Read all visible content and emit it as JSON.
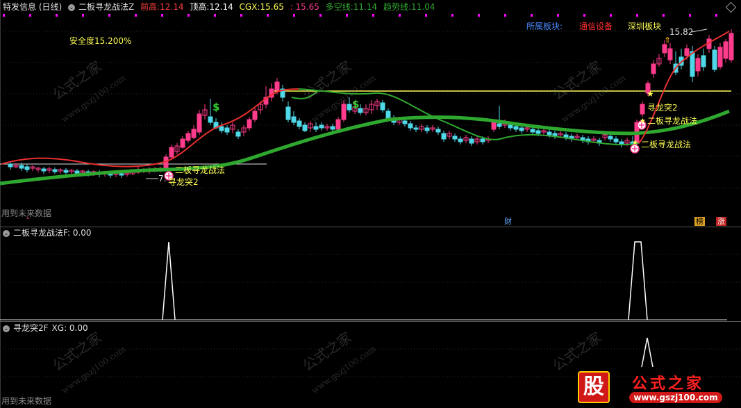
{
  "top_header": {
    "title": "特发信息 (日线)",
    "formula": "二板寻龙战法Z",
    "prev_high_label": "前高:",
    "prev_high_value": "12.14",
    "top_high_label": "顶高:",
    "top_high_value": "12.14",
    "cgx_label": "CGX:",
    "cgx_value": "15.65",
    "cgx_extra": ": 15.65",
    "duokong_label": "多空线:",
    "duokong_value": "11.14",
    "trend_label": "趋势线:",
    "trend_value": "11.04"
  },
  "main_panel": {
    "safety": "安全度15.200%",
    "sector_label": "所属板块:",
    "sector_1": "通信设备",
    "sector_2": "深圳板块",
    "label_dragon_1": "二板寻龙战法",
    "label_breakout_1": "寻龙突2",
    "label_low_price": "7.",
    "label_breakout_2": "寻龙突2",
    "label_dragon_2": "二板寻龙战法",
    "label_dragon_3": "二板寻龙战法",
    "label_high_price": "15.82",
    "dollar_1": "$",
    "dollar_2": "$",
    "future_data": "用到未来数据",
    "badge_cai": "财",
    "badge_bang": "榜",
    "badge_zhang": "涨"
  },
  "panel2": {
    "title": "二板寻龙战法F",
    "value": ": 0.00"
  },
  "panel3": {
    "title": "寻龙突2F",
    "xg": "XG: 0.00",
    "future_data": "用到未来数据"
  },
  "watermark": {
    "brand": "公式之家",
    "site": "www.gszj100.com",
    "logo_char": "股",
    "logo_text": "公式之家",
    "logo_url": "www.gszj100.com"
  },
  "colors": {
    "up_candle": "#ff3c8c",
    "down_candle": "#4fd8e8",
    "trend_line": "#2fa82f",
    "duokong_line": "#e83030",
    "resistance": "#ffff55",
    "label_yellow": "#ffff55"
  }
}
